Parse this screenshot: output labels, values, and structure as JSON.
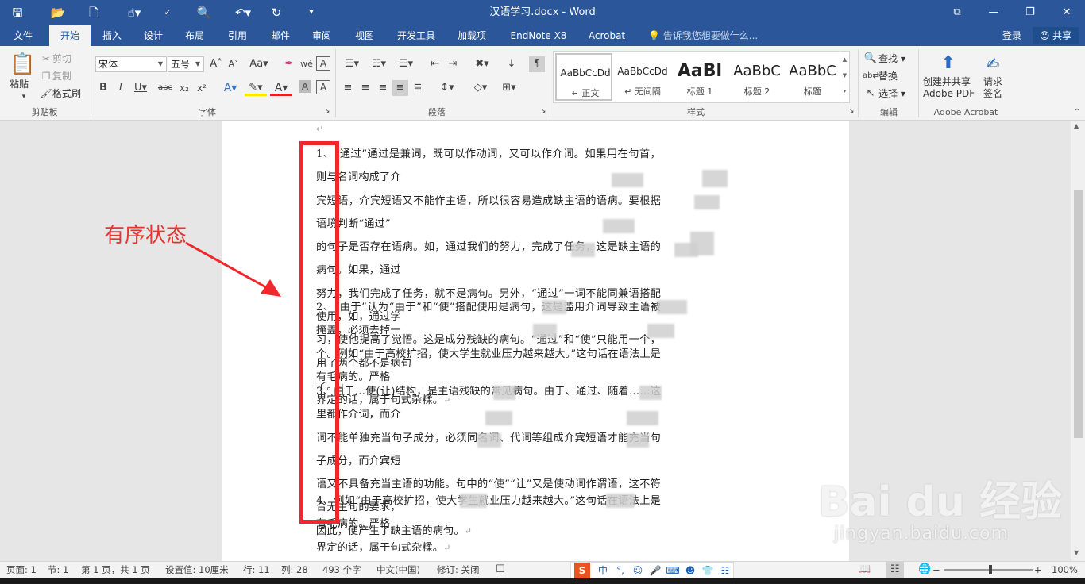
{
  "window": {
    "title": "汉语学习.docx - Word",
    "controls": {
      "restore_ribbon": "⧉",
      "minimize": "—",
      "maximize": "❐",
      "close": "✕"
    }
  },
  "quick_access": [
    {
      "name": "save-icon",
      "glyph": "💾"
    },
    {
      "name": "open-icon",
      "glyph": "📂"
    },
    {
      "name": "new-icon",
      "glyph": "🗋"
    },
    {
      "name": "touch-mode-icon",
      "glyph": "☝"
    },
    {
      "name": "spelling-icon",
      "glyph": "ABC"
    },
    {
      "name": "print-preview-icon",
      "glyph": "🔍"
    },
    {
      "name": "undo-icon",
      "glyph": "↶"
    },
    {
      "name": "redo-icon",
      "glyph": "↻"
    },
    {
      "name": "customize-qat-icon",
      "glyph": "▾"
    }
  ],
  "tabs": [
    "文件",
    "开始",
    "插入",
    "设计",
    "布局",
    "引用",
    "邮件",
    "审阅",
    "视图",
    "开发工具",
    "加载项",
    "EndNote X8",
    "Acrobat"
  ],
  "active_tab": "开始",
  "tell_me": "告诉我您想要做什么...",
  "login": "登录",
  "share": "共享",
  "ribbon": {
    "clipboard": {
      "paste": "粘贴",
      "cut": "剪切",
      "copy": "复制",
      "format_painter": "格式刷",
      "label": "剪贴板"
    },
    "font": {
      "font_name": "宋体",
      "font_size": "五号",
      "label": "字体"
    },
    "paragraph": {
      "label": "段落"
    },
    "styles": {
      "label": "样式",
      "items": [
        {
          "sample": "AaBbCcDd",
          "name": "正文"
        },
        {
          "sample": "AaBbCcDd",
          "name": "无间隔"
        },
        {
          "sample": "AaBl",
          "name": "标题 1"
        },
        {
          "sample": "AaBbC",
          "name": "标题 2"
        },
        {
          "sample": "AaBbC",
          "name": "标题"
        }
      ]
    },
    "editing": {
      "find": "查找",
      "replace": "替换",
      "select": "选择",
      "label": "编辑"
    },
    "acrobat": {
      "create_share": "创建并共享",
      "adobe_pdf": "Adobe PDF",
      "request": "请求",
      "sign": "签名",
      "label": "Adobe Acrobat"
    }
  },
  "document": {
    "paragraphs": [
      [
        "1、“通过”通过是兼词，既可以作动词，又可以作介词。如果用在句首，则与名词构成了介",
        "宾短语，介宾短语又不能作主语，所以很容易造成缺主语的语病。要根据语境判断“通过”",
        "的句子是否存在语病。如，通过我们的努力，完成了任务，这是缺主语的病句。如果，通过",
        "努力，我们完成了任务，就不是病句。另外，“通过”一词不能同兼语搭配使用，如，通过学",
        "习，使他提高了觉悟。这是成分残缺的病句。“通过”和“使”只能用一个，用了两个都不是病句",
        "了。"
      ],
      [
        "2、“由于”认为“由于”和“使”搭配使用是病句，这是滥用介词导致主语被掩盖，必须去掉一",
        "个。例如“由于高校扩招，使大学生就业压力越来越大。”这句话在语法上是有毛病的。严格",
        "界定的话，属于句式杂糅。"
      ],
      [
        "3、由于…使(让)结构，是主语残缺的常见病句。由于、通过、随着……这里都作介词，而介",
        "词不能单独充当句子成分，必须同名词、代词等组成介宾短语才能充当句子成分，而介宾短",
        "语又不具备充当主语的功能。句中的“使”“让”又是使动词作谓语，这不符合无主句的要求，",
        "因此，便产生了缺主语的病句。"
      ],
      [
        "4、例如“由于高校扩招，使大学生就业压力越来越大。”这句话在语法上是有毛病的。严格",
        "界定的话，属于句式杂糅。"
      ]
    ]
  },
  "annotation": {
    "text": "有序状态",
    "color": "#f0282d"
  },
  "watermark": {
    "logo": "Bai du 经验",
    "url": "jingyan.baidu.com"
  },
  "status": {
    "page": "页面: 1",
    "section": "节: 1",
    "page_of": "第 1 页，共 1 页",
    "setting": "设置值: 10厘米",
    "line": "行: 11",
    "column": "列: 28",
    "word_count": "493 个字",
    "language": "中文(中国)",
    "track_changes": "修订: 关闭",
    "zoom": "100%",
    "zoom_level": 1.0
  },
  "ime": {
    "logo": "S",
    "lang": "中"
  },
  "colors": {
    "accent": "#2b579a",
    "annotation": "#f0282d"
  }
}
